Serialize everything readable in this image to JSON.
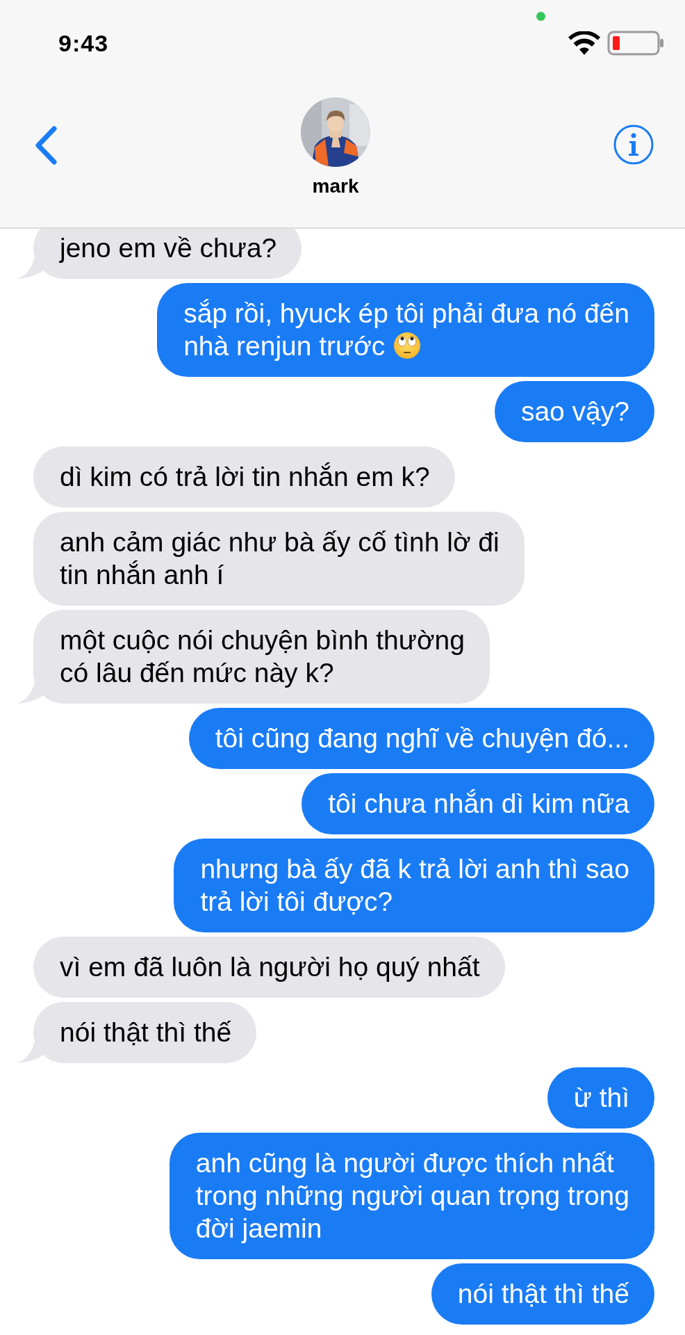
{
  "status_bar": {
    "time": "9:43",
    "camera_indicator": true
  },
  "header": {
    "contact_name": "mark"
  },
  "messages": [
    {
      "kind": "incoming",
      "lines": [
        "jeno em về chưa?"
      ],
      "tail": true
    },
    {
      "kind": "outgoing",
      "lines": [
        "sắp rồi, hyuck ép tôi phải đưa nó đến",
        "nhà renjun trước"
      ],
      "emoji_icon": true,
      "tail": false
    },
    {
      "kind": "outgoing",
      "lines": [
        "sao vậy?"
      ],
      "tail": false
    },
    {
      "kind": "incoming",
      "lines": [
        "dì kim có trả lời tin nhắn em k?"
      ],
      "tail": false
    },
    {
      "kind": "incoming",
      "lines": [
        "anh cảm giác như bà ấy cố tình lờ đi",
        "tin nhắn anh í"
      ],
      "tail": false
    },
    {
      "kind": "incoming",
      "lines": [
        "một cuộc nói chuyện bình thường",
        "có lâu đến mức này k?"
      ],
      "tail": true
    },
    {
      "kind": "outgoing",
      "lines": [
        "tôi cũng đang nghĩ về chuyện đó..."
      ],
      "tail": false
    },
    {
      "kind": "outgoing",
      "lines": [
        "tôi chưa nhắn dì kim nữa"
      ],
      "tail": false
    },
    {
      "kind": "outgoing",
      "lines": [
        "nhưng bà ấy đã k trả lời anh thì sao",
        "trả lời tôi được?"
      ],
      "tail": false
    },
    {
      "kind": "incoming",
      "lines": [
        "vì em đã luôn là người họ quý nhất"
      ],
      "tail": false
    },
    {
      "kind": "incoming",
      "lines": [
        "nói thật thì thế"
      ],
      "tail": true
    },
    {
      "kind": "outgoing",
      "lines": [
        "ừ thì"
      ],
      "tail": false
    },
    {
      "kind": "outgoing",
      "lines": [
        "anh cũng là người được thích nhất",
        "trong những người quan trọng trong",
        "đời jaemin"
      ],
      "tail": false
    },
    {
      "kind": "outgoing",
      "lines": [
        "nói thật thì thế"
      ],
      "tail": false
    }
  ]
}
